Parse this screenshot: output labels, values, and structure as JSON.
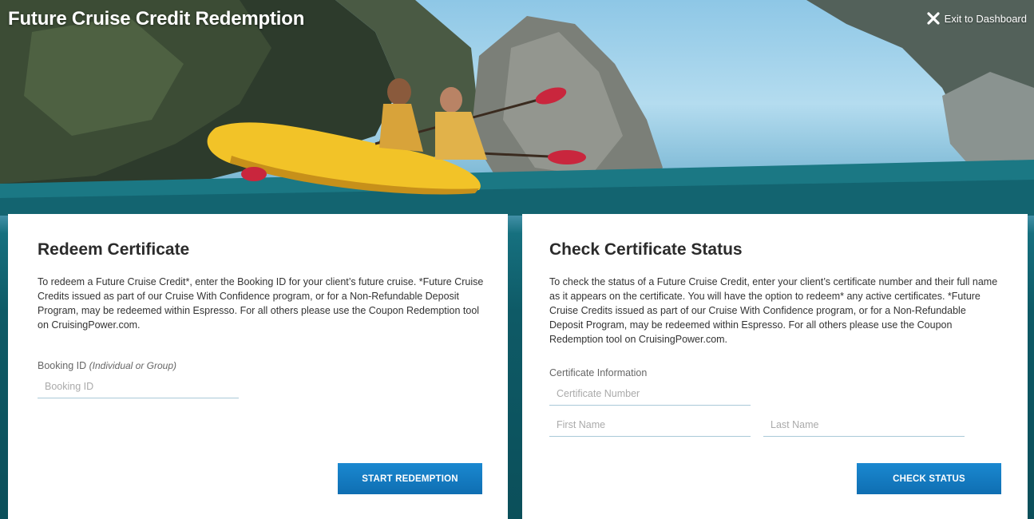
{
  "app": {
    "title": "Future Cruise Credit Redemption",
    "exit_label": "Exit to Dashboard"
  },
  "redeem": {
    "heading": "Redeem Certificate",
    "description": "To redeem a Future Cruise Credit*, enter the Booking ID for your client’s future cruise. *Future Cruise Credits issued as part of our Cruise With Confidence program, or for a Non-Refundable Deposit Program, may be redeemed within Espresso. For all others please use the Coupon Redemption tool on CruisingPower.com.",
    "booking_label": "Booking ID",
    "booking_hint": "(Individual or Group)",
    "booking_placeholder": "Booking ID",
    "booking_value": "",
    "button_label": "START REDEMPTION"
  },
  "status": {
    "heading": "Check Certificate Status",
    "description": "To check the status of a Future Cruise Credit, enter your client’s certificate number and their full name as it appears on the certificate. You will have the option to redeem* any active certificates. *Future Cruise Credits issued as part of our Cruise With Confidence program, or for a Non-Refundable Deposit Program, may be redeemed within Espresso. For all others please use the Coupon Redemption tool on CruisingPower.com.",
    "info_label": "Certificate Information",
    "certificate_placeholder": "Certificate Number",
    "first_name_placeholder": "First Name",
    "last_name_placeholder": "Last Name",
    "button_label": "CHECK STATUS"
  },
  "icons": {
    "exit": "close-icon"
  },
  "colors": {
    "button": "#1279c2",
    "input_underline": "#a9c9d8",
    "water": "#0e5a66"
  }
}
